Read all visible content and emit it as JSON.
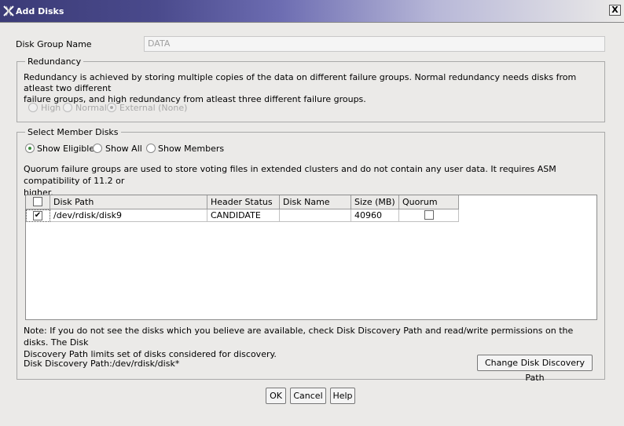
{
  "window": {
    "title": "Add Disks",
    "close_label": "X"
  },
  "disk_group": {
    "label": "Disk Group Name",
    "value": "DATA"
  },
  "redundancy": {
    "legend": "Redundancy",
    "description_line1": "Redundancy is achieved by storing multiple copies of the data on different failure groups. Normal redundancy needs disks from atleast two different",
    "description_line2": "failure groups, and high redundancy from atleast three different failure groups.",
    "options": [
      "High",
      "Normal",
      "External (None)"
    ],
    "selected": "External (None)"
  },
  "member_disks": {
    "legend": "Select Member Disks",
    "filters": [
      "Show Eligible",
      "Show All",
      "Show Members"
    ],
    "selected_filter": "Show Eligible",
    "quorum_note_line1": "Quorum failure groups are used to store voting files in extended clusters and do not contain any user data. It requires ASM compatibility of 11.2 or",
    "quorum_note_line2": "higher.",
    "table": {
      "columns": [
        "",
        "Disk Path",
        "Header Status",
        "Disk Name",
        "Size (MB)",
        "Quorum"
      ],
      "rows": [
        {
          "selected": true,
          "disk_path": "/dev/rdisk/disk9",
          "header_status": "CANDIDATE",
          "disk_name": "",
          "size_mb": "40960",
          "quorum": false
        }
      ]
    },
    "discovery_note_line1": "Note: If you do not see the disks which you believe are available, check Disk Discovery Path and read/write permissions on the disks. The Disk",
    "discovery_note_line2": "Discovery Path limits set of disks considered for discovery.",
    "discovery_path_text": "Disk Discovery Path:/dev/rdisk/disk*",
    "change_path_button": "Change Disk Discovery Path"
  },
  "buttons": {
    "ok": "OK",
    "cancel": "Cancel",
    "help": "Help"
  },
  "colors": {
    "accent": "#3b3b77",
    "radio_selected": "#3b8c3b"
  }
}
